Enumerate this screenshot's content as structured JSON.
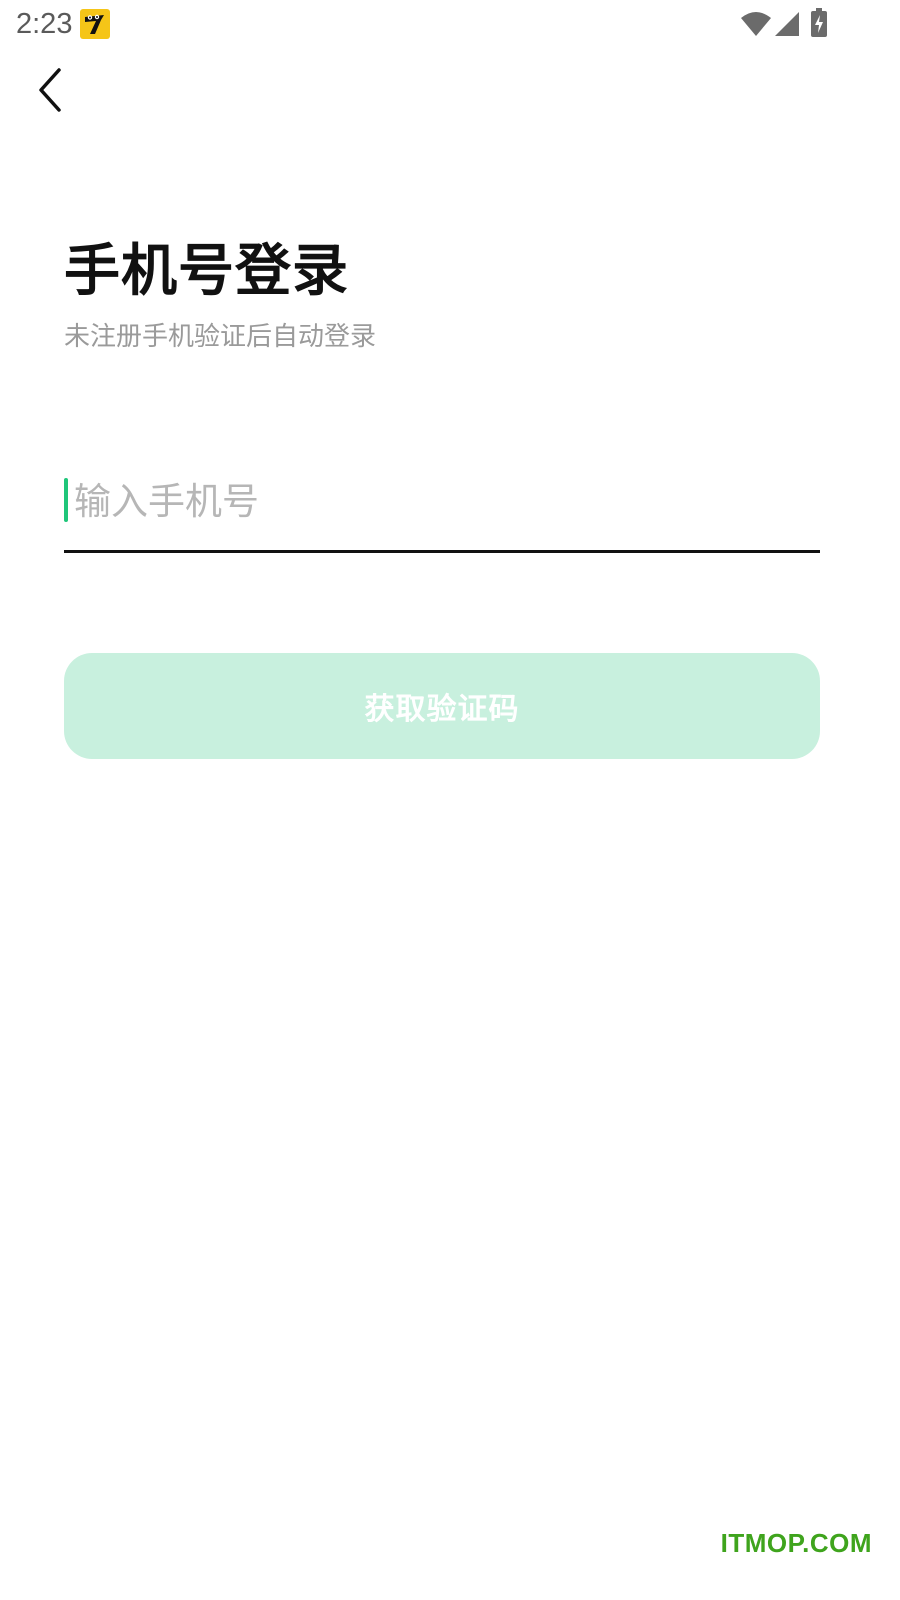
{
  "status_bar": {
    "time": "2:23",
    "icons": [
      "app-icon",
      "wifi-icon",
      "signal-icon",
      "battery-charging-icon"
    ]
  },
  "nav": {
    "back_icon": "chevron-left-icon"
  },
  "header": {
    "title": "手机号登录",
    "subtitle": "未注册手机验证后自动登录"
  },
  "form": {
    "phone_placeholder": "输入手机号",
    "phone_value": ""
  },
  "actions": {
    "get_code_label": "获取验证码"
  },
  "colors": {
    "accent": "#1fc67a",
    "button_disabled_bg": "#c8f0de",
    "watermark": "#3fa41d"
  },
  "watermark": "ITMOP.COM"
}
